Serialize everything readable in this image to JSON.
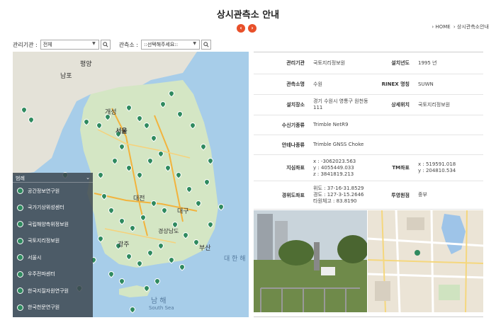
{
  "page": {
    "title": "상시관측소 안내"
  },
  "breadcrumb": {
    "home": "› HOME",
    "current": "› 상시관측소안내"
  },
  "filters": {
    "agency_label": "관리기관 :",
    "agency_value": "전체",
    "station_label": "관측소 :",
    "station_value": "::선택해주세요::"
  },
  "map": {
    "labels": [
      "남포",
      "평양",
      "개성",
      "서울",
      "대전",
      "대구",
      "광주",
      "경상남도",
      "부산",
      "대 한 해",
      "남 해",
      "South Sea"
    ]
  },
  "legend": {
    "title": "범례",
    "items": [
      "공간정보연구원",
      "국가기상위성센터",
      "국립해양측위정보원",
      "국토지리정보원",
      "서울시",
      "우주전파센터",
      "한국지질자원연구원",
      "한국천문연구원"
    ]
  },
  "info": {
    "rows": [
      {
        "l1": "관리기관",
        "v1": "국토지리정보원",
        "l2": "설치년도",
        "v2": "1995 년"
      },
      {
        "l1": "관측소명",
        "v1": "수원",
        "l2": "RINEX 명칭",
        "v2": "SUWN"
      },
      {
        "l1": "설치장소",
        "v1": "경기 수원시 영통구 원천동 111",
        "l2": "상세위치",
        "v2": "국토지리정보원"
      },
      {
        "l1": "수신기종류",
        "v1": "Trimble NetR9"
      },
      {
        "l1": "안테나종류",
        "v1": "Trimble GNSS Choke"
      },
      {
        "l1": "지심좌표",
        "v1": "x : -3062023.563\ny : 4055449.033\nz : 3841819.213",
        "l2": "TM좌표",
        "v2": "x : 519591.018\ny : 204810.534"
      },
      {
        "l1": "경위도좌표",
        "v1": "위도 : 37-16-31.8529\n경도 : 127-3-15.2646\n타원체고 : 83.8190",
        "l2": "투영원점",
        "v2": "중부"
      }
    ]
  }
}
